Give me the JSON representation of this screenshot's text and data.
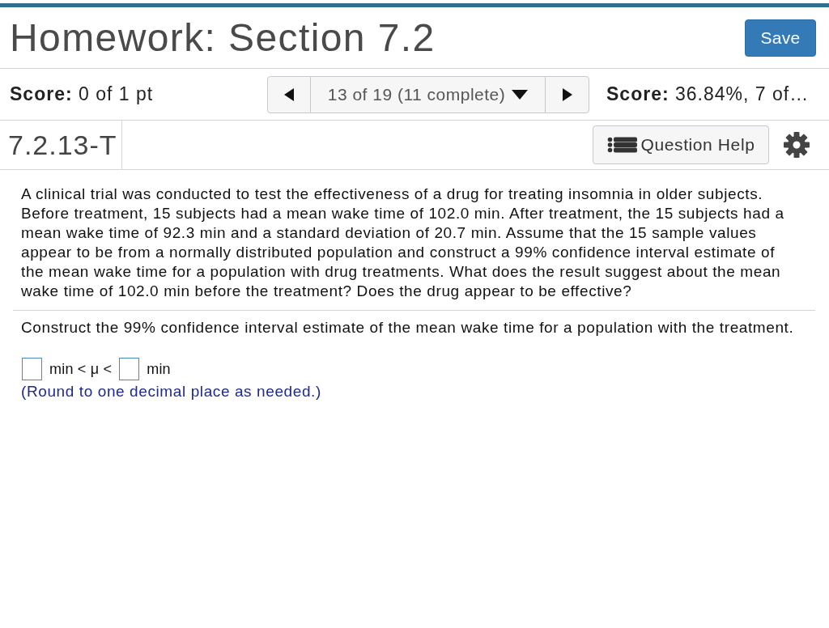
{
  "header": {
    "title": "Homework: Section 7.2",
    "save_button": "Save"
  },
  "score_bar": {
    "score": "**Score:** 0 of 1 pt",
    "navigator": {
      "position": "13 of 19 (11 complete)"
    },
    "hw_score": "**Score:** 36.84%, 7 of…"
  },
  "question_bar": {
    "question_id": "7.2.13-T",
    "help_button": "Question Help"
  },
  "question": {
    "text": "A clinical trial was conducted to test the effectiveness of a drug for treating insomnia in older subjects. Before treatment, 15 subjects had a mean wake time of 102.0 min. After treatment, the 15 subjects had a mean wake time of 92.3 min and a standard deviation of 20.7 min. Assume that the 15 sample values appear to be from a normally distributed population and construct a 99% confidence interval estimate of the mean wake time for a population with drug treatments. What does the result suggest about the mean wake time of 102.0 min before the treatment? Does the drug appear to be effective?",
    "prompt": "Construct the 99% confidence interval estimate of the mean wake time for a population with the treatment.",
    "answer_parts": [
      {
        "kind": "blank"
      },
      {
        "kind": "text",
        "text": "min < μ <"
      },
      {
        "kind": "blank"
      },
      {
        "kind": "text",
        "text": "min"
      }
    ],
    "note": "(Round to one decimal place as needed.)"
  }
}
